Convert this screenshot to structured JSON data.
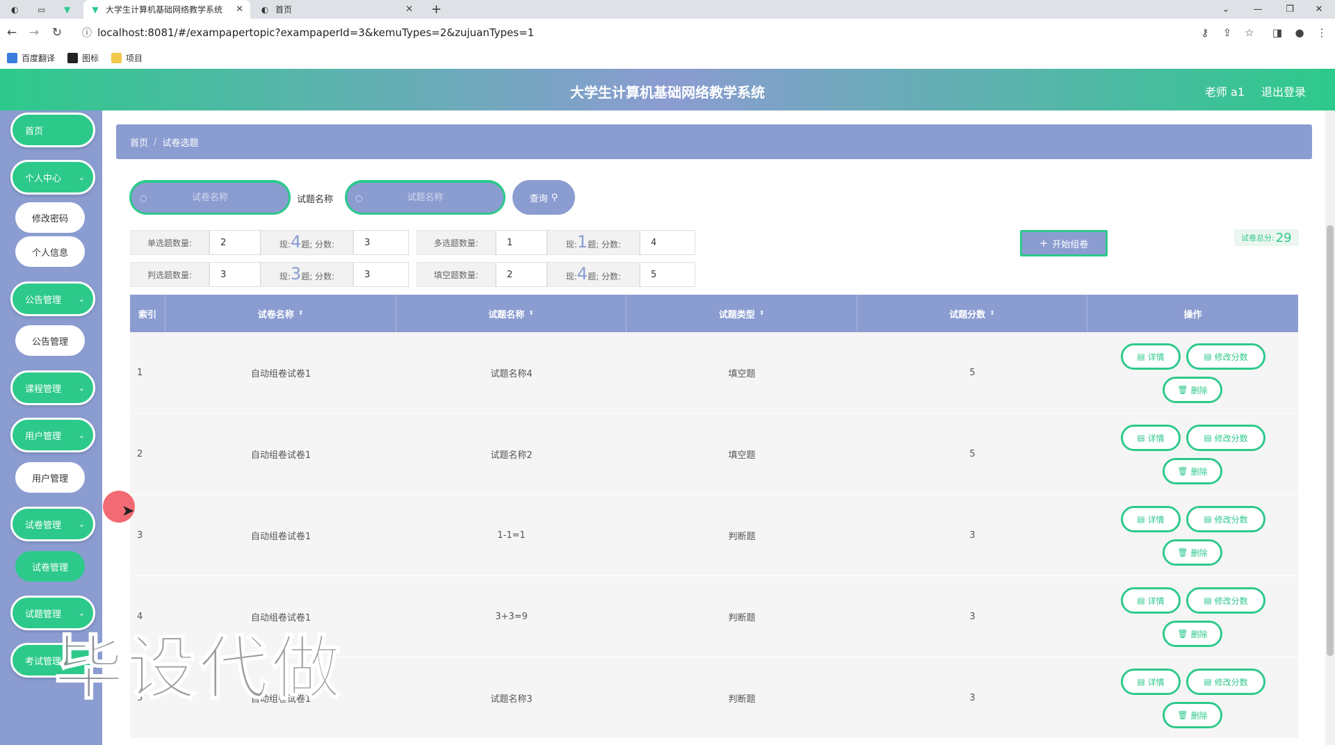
{
  "browser": {
    "tabs": [
      {
        "title": "大学生计算机基础网络教学系统",
        "active": true
      },
      {
        "title": "首页",
        "active": false
      }
    ],
    "new_tab": "+",
    "url": "localhost:8081/#/exampapertopic?exampaperId=3&kemuTypes=2&zujuanTypes=1",
    "bookmarks": [
      "百度翻译",
      "图标",
      "项目"
    ]
  },
  "header": {
    "title": "大学生计算机基础网络教学系统",
    "user": "老师 a1",
    "logout": "退出登录"
  },
  "sidebar": {
    "home": "首页",
    "personal_center": "个人中心",
    "change_password": "修改密码",
    "personal_info": "个人信息",
    "notice_mgmt": "公告管理",
    "notice_mgmt_sub": "公告管理",
    "course_mgmt": "课程管理",
    "user_mgmt": "用户管理",
    "user_mgmt_sub": "用户管理",
    "paper_mgmt": "试卷管理",
    "paper_mgmt_sub": "试卷管理",
    "question_mgmt": "试题管理",
    "exam_mgmt": "考试管理"
  },
  "breadcrumb": {
    "home": "首页",
    "sep": "/",
    "current": "试卷选题"
  },
  "search": {
    "paper_placeholder": "试卷名称",
    "question_label": "试题名称",
    "question_placeholder": "试题名称",
    "query_button": "查询"
  },
  "config": {
    "single": {
      "label": "单选题数量:",
      "count": "2",
      "now_prefix": "现:",
      "now": "4",
      "now_suffix": "题; 分数:",
      "score": "3"
    },
    "multi": {
      "label": "多选题数量:",
      "count": "1",
      "now_prefix": "现:",
      "now": "1",
      "now_suffix": "题; 分数:",
      "score": "4"
    },
    "judge": {
      "label": "判选题数量:",
      "count": "3",
      "now_prefix": "现:",
      "now": "3",
      "now_suffix": "题; 分数:",
      "score": "3"
    },
    "fill": {
      "label": "填空题数量:",
      "count": "2",
      "now_prefix": "现:",
      "now": "4",
      "now_suffix": "题; 分数:",
      "score": "5"
    }
  },
  "start_button": "开始组卷",
  "total": {
    "label": "试卷总分:",
    "value": "29"
  },
  "table": {
    "headers": [
      "索引",
      "试卷名称",
      "试题名称",
      "试题类型",
      "试题分数",
      "操作"
    ],
    "rows": [
      {
        "index": "1",
        "paper": "自动组卷试卷1",
        "question": "试题名称4",
        "type": "填空题",
        "score": "5"
      },
      {
        "index": "2",
        "paper": "自动组卷试卷1",
        "question": "试题名称2",
        "type": "填空题",
        "score": "5"
      },
      {
        "index": "3",
        "paper": "自动组卷试卷1",
        "question": "1-1=1",
        "type": "判断题",
        "score": "3"
      },
      {
        "index": "4",
        "paper": "自动组卷试卷1",
        "question": "3+3=9",
        "type": "判断题",
        "score": "3"
      },
      {
        "index": "5",
        "paper": "自动组卷试卷1",
        "question": "试题名称3",
        "type": "判断题",
        "score": "3"
      }
    ],
    "actions": {
      "detail": "详情",
      "edit_score": "修改分数",
      "delete": "删除"
    }
  },
  "watermark": "毕设代做",
  "colors": {
    "primary": "#2dc98b",
    "secondary": "#8b9cd1"
  }
}
